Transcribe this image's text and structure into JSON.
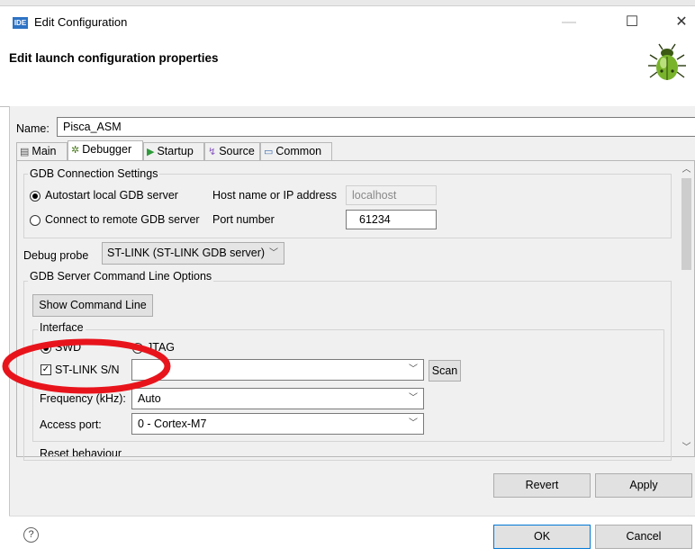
{
  "window": {
    "title": "Edit Configuration",
    "app_badge": "IDE"
  },
  "header": {
    "title": "Edit launch configuration properties"
  },
  "name": {
    "label": "Name:",
    "value": "Pisca_ASM"
  },
  "tabs": [
    {
      "label": "Main",
      "icon": "page-icon"
    },
    {
      "label": "Debugger",
      "icon": "bug-icon",
      "active": true
    },
    {
      "label": "Startup",
      "icon": "play-icon"
    },
    {
      "label": "Source",
      "icon": "source-icon"
    },
    {
      "label": "Common",
      "icon": "window-icon"
    }
  ],
  "gdb_connection": {
    "group_label": "GDB Connection Settings",
    "autostart_label": "Autostart local GDB server",
    "remote_label": "Connect to remote GDB server",
    "host_label": "Host name or IP address",
    "host_value": "localhost",
    "port_label": "Port number",
    "port_value": "61234"
  },
  "probe": {
    "label": "Debug probe",
    "value": "ST-LINK (ST-LINK GDB server)"
  },
  "server_options": {
    "group_label": "GDB Server Command Line Options",
    "show_cmd_label": "Show Command Line",
    "interface": {
      "group_label": "Interface",
      "swd_label": "SWD",
      "jtag_label": "JTAG"
    },
    "stlink_label": "ST-LINK S/N",
    "stlink_value": "",
    "scan_label": "Scan",
    "frequency_label": "Frequency (kHz):",
    "frequency_value": "Auto",
    "access_port_label": "Access port:",
    "access_port_value": "0 - Cortex-M7",
    "reset_label": "Reset behaviour"
  },
  "buttons": {
    "revert": "Revert",
    "apply": "Apply",
    "ok": "OK",
    "cancel": "Cancel",
    "help": "?"
  },
  "colors": {
    "accent": "#0078d7",
    "annotation": "#e8141c",
    "ide_badge": "#2d73c4"
  }
}
